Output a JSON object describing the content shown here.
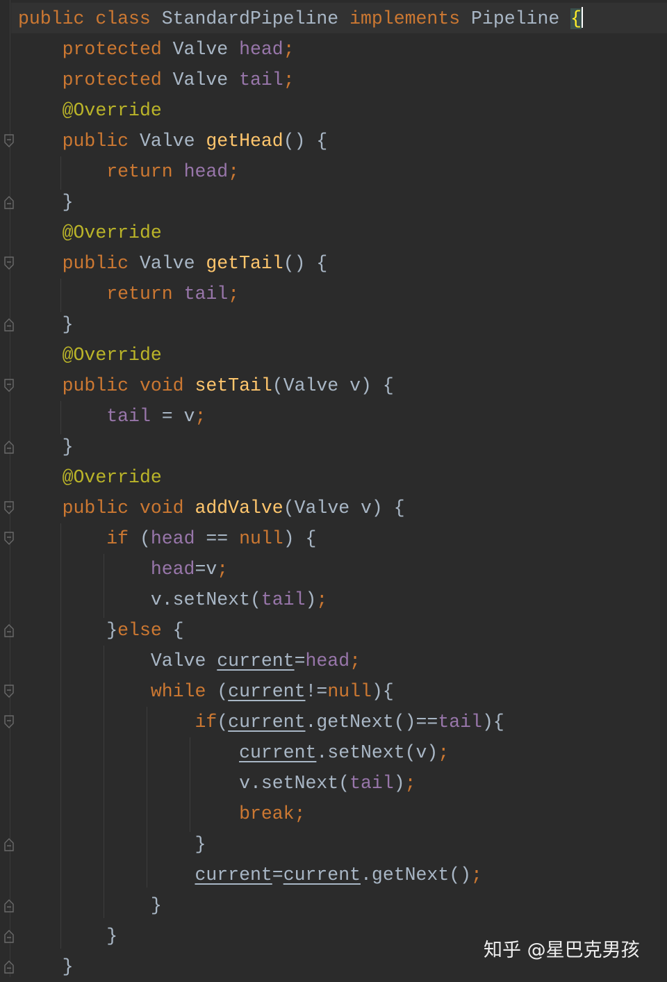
{
  "editor": {
    "theme": "darcula",
    "colors": {
      "background": "#2b2b2b",
      "keyword": "#cc7832",
      "field": "#9876aa",
      "method": "#ffc66d",
      "annotation": "#bbb529",
      "plain": "#a9b7c6"
    },
    "lines": [
      [
        {
          "t": "kw",
          "v": "public class "
        },
        {
          "t": "pl",
          "v": "StandardPipeline "
        },
        {
          "t": "kw",
          "v": "implements "
        },
        {
          "t": "pl",
          "v": "Pipeline "
        },
        {
          "t": "brace-hl",
          "v": "{"
        }
      ],
      [
        {
          "t": "sp",
          "v": "    "
        },
        {
          "t": "kw",
          "v": "protected "
        },
        {
          "t": "pl",
          "v": "Valve "
        },
        {
          "t": "fld",
          "v": "head"
        },
        {
          "t": "kw",
          "v": ";"
        }
      ],
      [
        {
          "t": "sp",
          "v": "    "
        },
        {
          "t": "kw",
          "v": "protected "
        },
        {
          "t": "pl",
          "v": "Valve "
        },
        {
          "t": "fld",
          "v": "tail"
        },
        {
          "t": "kw",
          "v": ";"
        }
      ],
      [
        {
          "t": "sp",
          "v": "    "
        },
        {
          "t": "ann",
          "v": "@Override"
        }
      ],
      [
        {
          "t": "sp",
          "v": "    "
        },
        {
          "t": "kw",
          "v": "public "
        },
        {
          "t": "pl",
          "v": "Valve "
        },
        {
          "t": "fn",
          "v": "getHead"
        },
        {
          "t": "pl",
          "v": "() {"
        }
      ],
      [
        {
          "t": "sp",
          "v": "        "
        },
        {
          "t": "kw",
          "v": "return "
        },
        {
          "t": "fld",
          "v": "head"
        },
        {
          "t": "kw",
          "v": ";"
        }
      ],
      [
        {
          "t": "sp",
          "v": "    "
        },
        {
          "t": "pl",
          "v": "}"
        }
      ],
      [
        {
          "t": "sp",
          "v": "    "
        },
        {
          "t": "ann",
          "v": "@Override"
        }
      ],
      [
        {
          "t": "sp",
          "v": "    "
        },
        {
          "t": "kw",
          "v": "public "
        },
        {
          "t": "pl",
          "v": "Valve "
        },
        {
          "t": "fn",
          "v": "getTail"
        },
        {
          "t": "pl",
          "v": "() {"
        }
      ],
      [
        {
          "t": "sp",
          "v": "        "
        },
        {
          "t": "kw",
          "v": "return "
        },
        {
          "t": "fld",
          "v": "tail"
        },
        {
          "t": "kw",
          "v": ";"
        }
      ],
      [
        {
          "t": "sp",
          "v": "    "
        },
        {
          "t": "pl",
          "v": "}"
        }
      ],
      [
        {
          "t": "sp",
          "v": "    "
        },
        {
          "t": "ann",
          "v": "@Override"
        }
      ],
      [
        {
          "t": "sp",
          "v": "    "
        },
        {
          "t": "kw",
          "v": "public void "
        },
        {
          "t": "fn",
          "v": "setTail"
        },
        {
          "t": "pl",
          "v": "(Valve v) {"
        }
      ],
      [
        {
          "t": "sp",
          "v": "        "
        },
        {
          "t": "fld",
          "v": "tail "
        },
        {
          "t": "pl",
          "v": "= v"
        },
        {
          "t": "kw",
          "v": ";"
        }
      ],
      [
        {
          "t": "sp",
          "v": "    "
        },
        {
          "t": "pl",
          "v": "}"
        }
      ],
      [
        {
          "t": "sp",
          "v": "    "
        },
        {
          "t": "ann",
          "v": "@Override"
        }
      ],
      [
        {
          "t": "sp",
          "v": "    "
        },
        {
          "t": "kw",
          "v": "public void "
        },
        {
          "t": "fn",
          "v": "addValve"
        },
        {
          "t": "pl",
          "v": "(Valve v) {"
        }
      ],
      [
        {
          "t": "sp",
          "v": "        "
        },
        {
          "t": "kw",
          "v": "if "
        },
        {
          "t": "pl",
          "v": "("
        },
        {
          "t": "fld",
          "v": "head "
        },
        {
          "t": "pl",
          "v": "== "
        },
        {
          "t": "kw",
          "v": "null"
        },
        {
          "t": "pl",
          "v": ") {"
        }
      ],
      [
        {
          "t": "sp",
          "v": "            "
        },
        {
          "t": "fld",
          "v": "head"
        },
        {
          "t": "pl",
          "v": "=v"
        },
        {
          "t": "kw",
          "v": ";"
        }
      ],
      [
        {
          "t": "sp",
          "v": "            "
        },
        {
          "t": "pl",
          "v": "v.setNext("
        },
        {
          "t": "fld",
          "v": "tail"
        },
        {
          "t": "pl",
          "v": ")"
        },
        {
          "t": "kw",
          "v": ";"
        }
      ],
      [
        {
          "t": "sp",
          "v": "        "
        },
        {
          "t": "pl",
          "v": "}"
        },
        {
          "t": "kw",
          "v": "else "
        },
        {
          "t": "pl",
          "v": "{"
        }
      ],
      [
        {
          "t": "sp",
          "v": "            "
        },
        {
          "t": "pl",
          "v": "Valve "
        },
        {
          "t": "var",
          "v": "current"
        },
        {
          "t": "pl",
          "v": "="
        },
        {
          "t": "fld",
          "v": "head"
        },
        {
          "t": "kw",
          "v": ";"
        }
      ],
      [
        {
          "t": "sp",
          "v": "            "
        },
        {
          "t": "kw",
          "v": "while "
        },
        {
          "t": "pl",
          "v": "("
        },
        {
          "t": "var",
          "v": "current"
        },
        {
          "t": "pl",
          "v": "!="
        },
        {
          "t": "kw",
          "v": "null"
        },
        {
          "t": "pl",
          "v": "){"
        }
      ],
      [
        {
          "t": "sp",
          "v": "                "
        },
        {
          "t": "kw",
          "v": "if"
        },
        {
          "t": "pl",
          "v": "("
        },
        {
          "t": "var",
          "v": "current"
        },
        {
          "t": "pl",
          "v": ".getNext()=="
        },
        {
          "t": "fld",
          "v": "tail"
        },
        {
          "t": "pl",
          "v": "){"
        }
      ],
      [
        {
          "t": "sp",
          "v": "                    "
        },
        {
          "t": "var",
          "v": "current"
        },
        {
          "t": "pl",
          "v": ".setNext(v)"
        },
        {
          "t": "kw",
          "v": ";"
        }
      ],
      [
        {
          "t": "sp",
          "v": "                    "
        },
        {
          "t": "pl",
          "v": "v.setNext("
        },
        {
          "t": "fld",
          "v": "tail"
        },
        {
          "t": "pl",
          "v": ")"
        },
        {
          "t": "kw",
          "v": ";"
        }
      ],
      [
        {
          "t": "sp",
          "v": "                    "
        },
        {
          "t": "kw",
          "v": "break;"
        }
      ],
      [
        {
          "t": "sp",
          "v": "                "
        },
        {
          "t": "pl",
          "v": "}"
        }
      ],
      [
        {
          "t": "sp",
          "v": "                "
        },
        {
          "t": "var",
          "v": "current"
        },
        {
          "t": "pl",
          "v": "="
        },
        {
          "t": "var",
          "v": "current"
        },
        {
          "t": "pl",
          "v": ".getNext()"
        },
        {
          "t": "kw",
          "v": ";"
        }
      ],
      [
        {
          "t": "sp",
          "v": "            "
        },
        {
          "t": "pl",
          "v": "}"
        }
      ],
      [
        {
          "t": "sp",
          "v": "        "
        },
        {
          "t": "pl",
          "v": "}"
        }
      ],
      [
        {
          "t": "sp",
          "v": "    "
        },
        {
          "t": "pl",
          "v": "}"
        }
      ]
    ],
    "fold_markers": [
      {
        "line": 4,
        "kind": "open"
      },
      {
        "line": 6,
        "kind": "close"
      },
      {
        "line": 8,
        "kind": "open"
      },
      {
        "line": 10,
        "kind": "close"
      },
      {
        "line": 12,
        "kind": "open"
      },
      {
        "line": 14,
        "kind": "close"
      },
      {
        "line": 16,
        "kind": "open"
      },
      {
        "line": 17,
        "kind": "open"
      },
      {
        "line": 20,
        "kind": "close"
      },
      {
        "line": 22,
        "kind": "open"
      },
      {
        "line": 23,
        "kind": "open"
      },
      {
        "line": 27,
        "kind": "close"
      },
      {
        "line": 29,
        "kind": "close"
      },
      {
        "line": 30,
        "kind": "close"
      },
      {
        "line": 31,
        "kind": "close"
      }
    ]
  },
  "watermark": {
    "text": "知乎 @星巴克男孩"
  }
}
